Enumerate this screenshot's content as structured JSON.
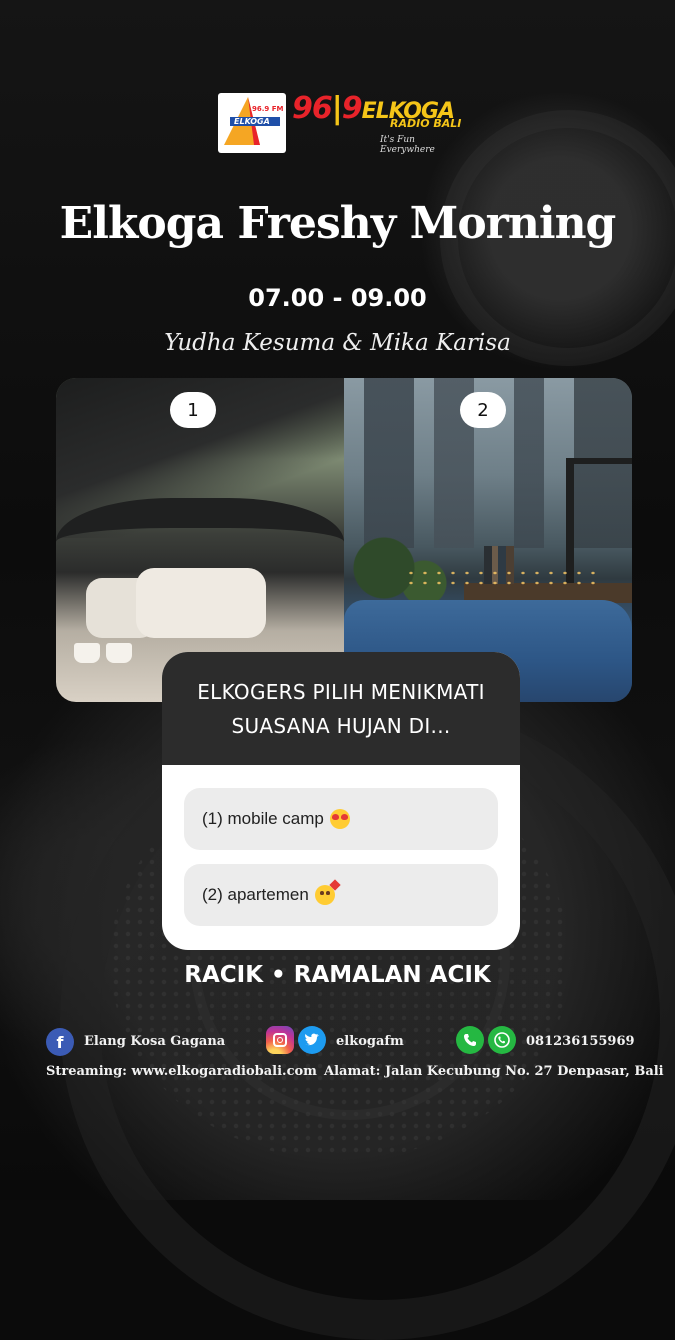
{
  "logo": {
    "frequency": "96.9 FM",
    "brand": "ELKOGA",
    "big_number": "96",
    "big_number_b": "9",
    "big_name": "ELKOGA",
    "sub": "RADIO BALI",
    "tagline": "It's Fun Everywhere"
  },
  "show": {
    "title": "Elkoga Freshy Morning",
    "time": "07.00 - 09.00",
    "hosts": "Yudha Kesuma & Mika Karisa"
  },
  "photos": [
    {
      "badge": "1"
    },
    {
      "badge": "2"
    }
  ],
  "poll": {
    "question_line1": "ELKOGERS PILIH MENIKMATI",
    "question_line2": "SUASANA HUJAN DI...",
    "options": [
      {
        "label": "(1) mobile camp",
        "emoji": "heart-eyes-emoji"
      },
      {
        "label": "(2) apartemen",
        "emoji": "smiling-face-with-hearts-emoji"
      }
    ]
  },
  "segment": "RACIK • RAMALAN ACIK",
  "footer": {
    "facebook": "Elang Kosa Gagana",
    "social_handle": "elkogafm",
    "phone": "081236155969",
    "streaming": "Streaming: www.elkogaradiobali.com",
    "address": "Alamat: Jalan Kecubung No. 27 Denpasar, Bali"
  },
  "colors": {
    "brand_red": "#e8232a",
    "brand_yellow": "#f5c518",
    "poll_header": "#2c2c2c",
    "option_bg": "#ececec"
  }
}
